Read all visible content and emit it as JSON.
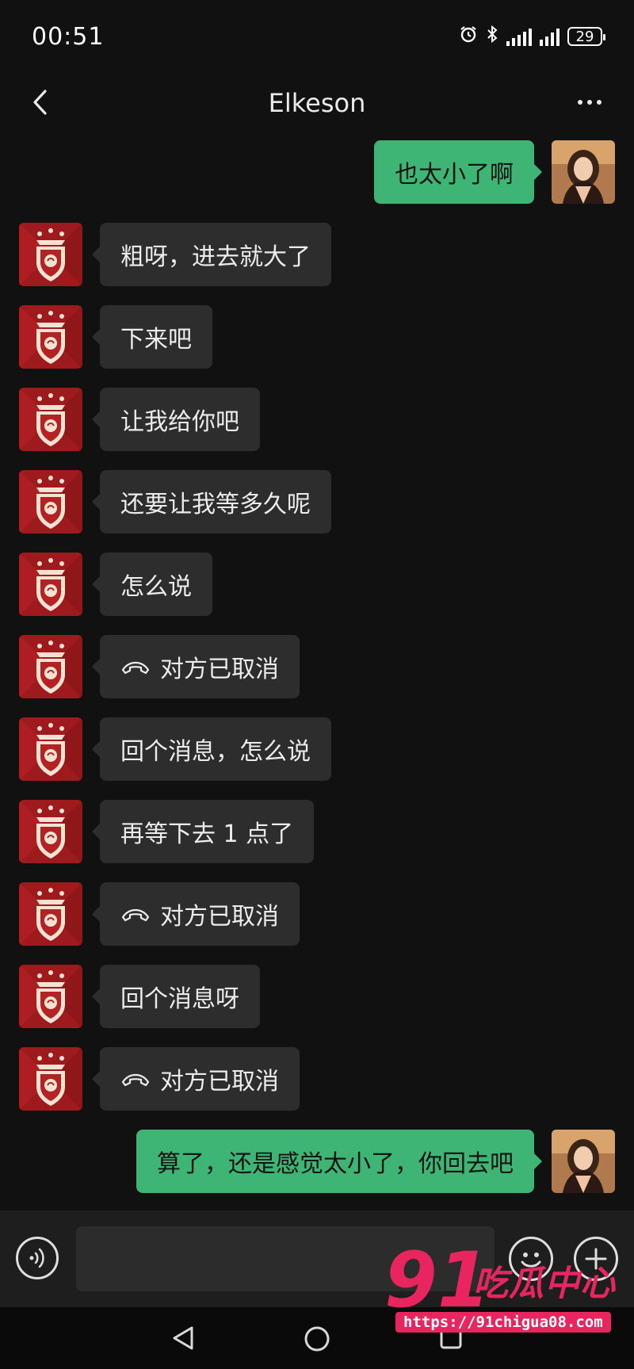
{
  "status_bar": {
    "time": "00:51",
    "battery": "29"
  },
  "header": {
    "title": "Elkeson"
  },
  "messages": [
    {
      "side": "out",
      "text": "也太小了啊"
    },
    {
      "side": "in",
      "text": "粗呀，进去就大了"
    },
    {
      "side": "in",
      "text": "下来吧"
    },
    {
      "side": "in",
      "text": "让我给你吧"
    },
    {
      "side": "in",
      "text": "还要让我等多久呢"
    },
    {
      "side": "in",
      "text": "怎么说"
    },
    {
      "side": "in",
      "type": "call",
      "text": "对方已取消"
    },
    {
      "side": "in",
      "text": "回个消息，怎么说"
    },
    {
      "side": "in",
      "text": "再等下去 1 点了"
    },
    {
      "side": "in",
      "type": "call",
      "text": "对方已取消"
    },
    {
      "side": "in",
      "text": "回个消息呀"
    },
    {
      "side": "in",
      "type": "call",
      "text": "对方已取消"
    },
    {
      "side": "out",
      "text": "算了，还是感觉太小了，你回去吧"
    }
  ],
  "icons": {
    "back": "chevron-left-icon",
    "more": "more-dots-icon",
    "voice": "voice-input-icon",
    "emoji": "emoji-icon",
    "plus": "plus-icon",
    "call": "call-ended-icon"
  },
  "colors": {
    "background": "#111111",
    "incoming_bubble": "#2d2d2d",
    "outgoing_bubble": "#3eb575",
    "watermark": "#e8255e"
  },
  "watermark": {
    "brand_number": "91",
    "brand_text": "吃瓜中心",
    "url": "https://91chigua08.com"
  }
}
